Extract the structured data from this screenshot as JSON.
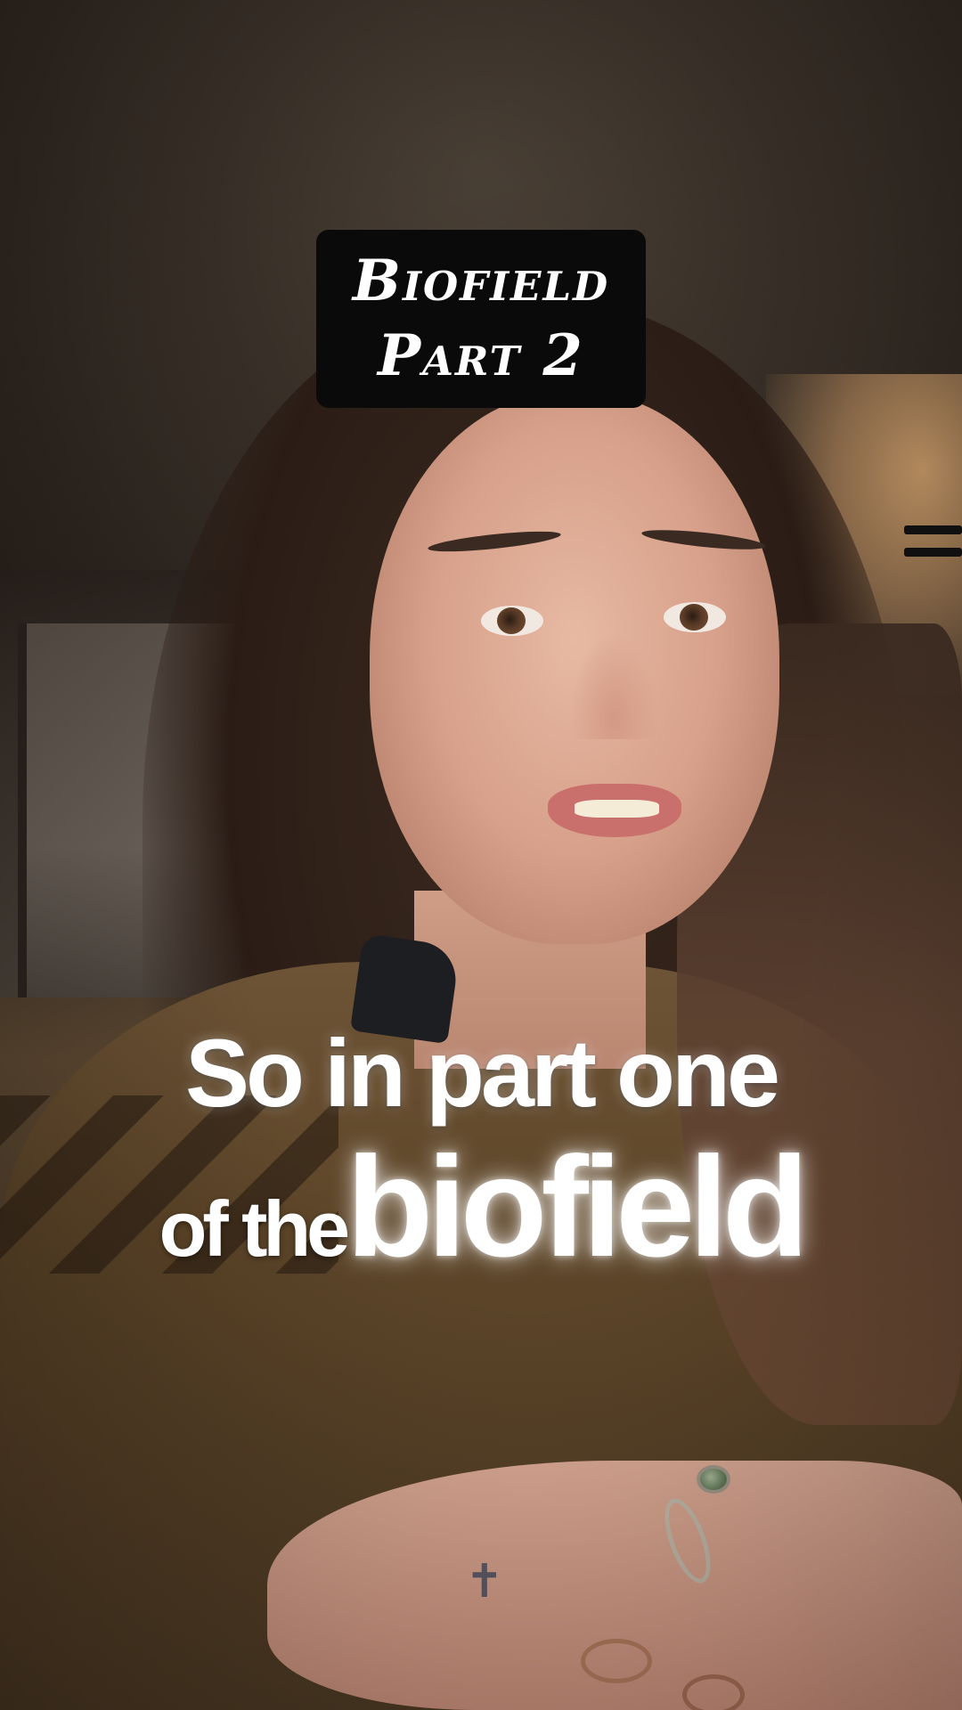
{
  "title_card": {
    "line1": "Biofield",
    "line2": "Part 2"
  },
  "caption": {
    "line1": "So in part one",
    "line2_small": "of the",
    "line2_big": "biofield"
  },
  "icons": {
    "tattoo": "cross-tattoo-icon"
  }
}
